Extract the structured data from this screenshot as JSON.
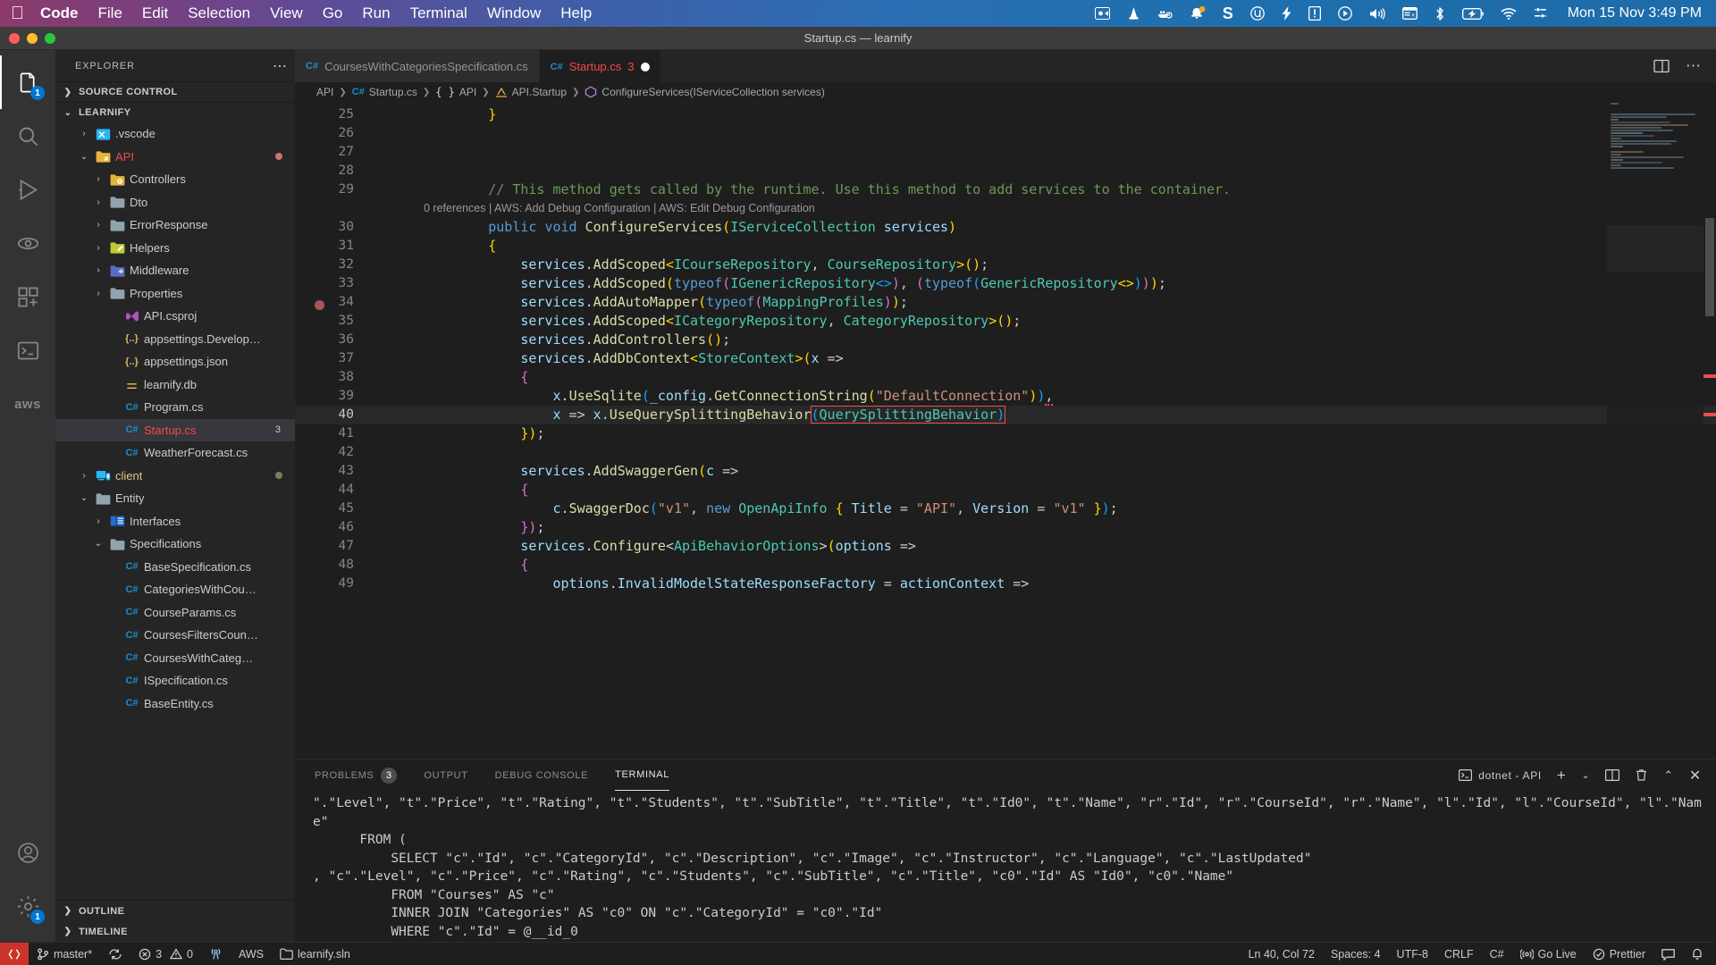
{
  "menubar": {
    "apple": "apple-logo",
    "items": [
      {
        "label": "Code",
        "bold": true
      },
      {
        "label": "File",
        "bold": false
      },
      {
        "label": "Edit",
        "bold": false
      },
      {
        "label": "Selection",
        "bold": false
      },
      {
        "label": "View",
        "bold": false
      },
      {
        "label": "Go",
        "bold": false
      },
      {
        "label": "Run",
        "bold": false
      },
      {
        "label": "Terminal",
        "bold": false
      },
      {
        "label": "Window",
        "bold": false
      },
      {
        "label": "Help",
        "bold": false
      }
    ],
    "tray_icons": [
      "screen-record-icon",
      "vlc-cone-icon",
      "docker-whale-icon",
      "notification-bell-icon",
      "sublime-s-icon",
      "utorrent-icon",
      "lightning-icon",
      "alert-exclamation-icon",
      "play-circle-icon",
      "volume-icon",
      "window-list-icon",
      "bluetooth-icon",
      "battery-charging-icon",
      "wifi-icon",
      "control-center-icon"
    ],
    "clock": "Mon 15 Nov  3:49 PM"
  },
  "window": {
    "title": "Startup.cs — learnify",
    "traffic_lights": [
      "close-button",
      "minimize-button",
      "maximize-button"
    ]
  },
  "activitybar": {
    "items": [
      {
        "name": "explorer",
        "icon": "files-icon",
        "active": true,
        "badge": "1"
      },
      {
        "name": "search",
        "icon": "search-icon",
        "active": false,
        "badge": ""
      },
      {
        "name": "run-and-debug",
        "icon": "debug-icon",
        "active": false,
        "badge": ""
      },
      {
        "name": "remote-explorer",
        "icon": "remote-icon",
        "active": false,
        "badge": ""
      },
      {
        "name": "extensions",
        "icon": "extensions-icon",
        "active": false,
        "badge": ""
      },
      {
        "name": "terminal-sidebar",
        "icon": "terminal-icon",
        "active": false,
        "badge": ""
      },
      {
        "name": "aws-toolkit",
        "icon": "aws-icon",
        "active": false,
        "badge": ""
      }
    ],
    "bottom": [
      {
        "name": "accounts",
        "icon": "account-icon",
        "badge": ""
      },
      {
        "name": "manage-settings",
        "icon": "gear-icon",
        "badge": "1"
      }
    ]
  },
  "sidebar": {
    "title": "EXPLORER",
    "actions_icon": "ellipsis-icon",
    "sections": [
      {
        "label": "SOURCE CONTROL",
        "expanded": false
      },
      {
        "label": "LEARNIFY",
        "expanded": true
      }
    ],
    "tree": [
      {
        "label": ".vscode",
        "indent": 1,
        "twisty": "›",
        "icon": "vscode-folder-icon",
        "iconColor": "#29b6f6",
        "kind": "folder",
        "color": "#cccccc"
      },
      {
        "label": "API",
        "indent": 1,
        "twisty": "⌄",
        "icon": "csharp-folder-icon",
        "iconColor": "#e8b339",
        "kind": "folder",
        "color": "#f14c4c",
        "dot": "#c4786b"
      },
      {
        "label": "Controllers",
        "indent": 2,
        "twisty": "›",
        "icon": "controllers-folder-icon",
        "iconColor": "#e8b339",
        "kind": "folder",
        "color": "#cccccc"
      },
      {
        "label": "Dto",
        "indent": 2,
        "twisty": "›",
        "icon": "folder-icon",
        "iconColor": "#90a4ae",
        "kind": "folder",
        "color": "#cccccc"
      },
      {
        "label": "ErrorResponse",
        "indent": 2,
        "twisty": "›",
        "icon": "folder-icon",
        "iconColor": "#90a4ae",
        "kind": "folder",
        "color": "#cccccc"
      },
      {
        "label": "Helpers",
        "indent": 2,
        "twisty": "›",
        "icon": "helpers-folder-icon",
        "iconColor": "#c0ca33",
        "kind": "folder",
        "color": "#cccccc"
      },
      {
        "label": "Middleware",
        "indent": 2,
        "twisty": "›",
        "icon": "middleware-folder-icon",
        "iconColor": "#5c6bc0",
        "kind": "folder",
        "color": "#cccccc"
      },
      {
        "label": "Properties",
        "indent": 2,
        "twisty": "›",
        "icon": "folder-icon",
        "iconColor": "#90a4ae",
        "kind": "folder",
        "color": "#cccccc"
      },
      {
        "label": "API.csproj",
        "indent": 3,
        "twisty": "",
        "icon": "visualstudio-icon",
        "iconColor": "#b052c0",
        "kind": "file",
        "color": "#cccccc"
      },
      {
        "label": "appsettings.Develop…",
        "indent": 3,
        "twisty": "",
        "icon": "json-icon",
        "iconColor": "#d7ba5d",
        "kind": "file",
        "color": "#cccccc"
      },
      {
        "label": "appsettings.json",
        "indent": 3,
        "twisty": "",
        "icon": "json-icon",
        "iconColor": "#d7ba5d",
        "kind": "file",
        "color": "#cccccc"
      },
      {
        "label": "learnify.db",
        "indent": 3,
        "twisty": "",
        "icon": "database-icon",
        "iconColor": "#e8c44a",
        "kind": "file",
        "color": "#cccccc"
      },
      {
        "label": "Program.cs",
        "indent": 3,
        "twisty": "",
        "icon": "csharp-icon",
        "iconColor": "#1f8ad2",
        "kind": "file",
        "color": "#cccccc"
      },
      {
        "label": "Startup.cs",
        "indent": 3,
        "twisty": "",
        "icon": "csharp-icon",
        "iconColor": "#1f8ad2",
        "kind": "file",
        "color": "#f14c4c",
        "selected": true,
        "count": "3"
      },
      {
        "label": "WeatherForecast.cs",
        "indent": 3,
        "twisty": "",
        "icon": "csharp-icon",
        "iconColor": "#1f8ad2",
        "kind": "file",
        "color": "#cccccc"
      },
      {
        "label": "client",
        "indent": 1,
        "twisty": "›",
        "icon": "client-folder-icon",
        "iconColor": "#29b6f6",
        "kind": "folder",
        "color": "#e2c08d",
        "dot": "#7d7d5f"
      },
      {
        "label": "Entity",
        "indent": 1,
        "twisty": "⌄",
        "icon": "folder-icon",
        "iconColor": "#90a4ae",
        "kind": "folder",
        "color": "#cccccc"
      },
      {
        "label": "Interfaces",
        "indent": 2,
        "twisty": "›",
        "icon": "interfaces-folder-icon",
        "iconColor": "#1f6fd0",
        "kind": "folder",
        "color": "#cccccc"
      },
      {
        "label": "Specifications",
        "indent": 2,
        "twisty": "⌄",
        "icon": "folder-icon",
        "iconColor": "#90a4ae",
        "kind": "folder",
        "color": "#cccccc"
      },
      {
        "label": "BaseSpecification.cs",
        "indent": 3,
        "twisty": "",
        "icon": "csharp-icon",
        "iconColor": "#1f8ad2",
        "kind": "file",
        "color": "#cccccc"
      },
      {
        "label": "CategoriesWithCou…",
        "indent": 3,
        "twisty": "",
        "icon": "csharp-icon",
        "iconColor": "#1f8ad2",
        "kind": "file",
        "color": "#cccccc"
      },
      {
        "label": "CourseParams.cs",
        "indent": 3,
        "twisty": "",
        "icon": "csharp-icon",
        "iconColor": "#1f8ad2",
        "kind": "file",
        "color": "#cccccc"
      },
      {
        "label": "CoursesFiltersCoun…",
        "indent": 3,
        "twisty": "",
        "icon": "csharp-icon",
        "iconColor": "#1f8ad2",
        "kind": "file",
        "color": "#cccccc"
      },
      {
        "label": "CoursesWithCateg…",
        "indent": 3,
        "twisty": "",
        "icon": "csharp-icon",
        "iconColor": "#1f8ad2",
        "kind": "file",
        "color": "#cccccc"
      },
      {
        "label": "ISpecification.cs",
        "indent": 3,
        "twisty": "",
        "icon": "csharp-icon",
        "iconColor": "#1f8ad2",
        "kind": "file",
        "color": "#cccccc"
      },
      {
        "label": "BaseEntity.cs",
        "indent": 3,
        "twisty": "",
        "icon": "csharp-icon",
        "iconColor": "#1f8ad2",
        "kind": "file",
        "color": "#cccccc"
      }
    ],
    "bottom_sections": [
      {
        "label": "OUTLINE",
        "expanded": false
      },
      {
        "label": "TIMELINE",
        "expanded": false
      }
    ]
  },
  "editor": {
    "tabs": [
      {
        "label": "CoursesWithCategoriesSpecification.cs",
        "icon": "csharp-icon",
        "active": false,
        "errors": "",
        "dirty": false
      },
      {
        "label": "Startup.cs",
        "icon": "csharp-icon",
        "active": true,
        "errors": "3",
        "dirty": true
      }
    ],
    "tab_actions": [
      "split-editor-icon",
      "more-actions-icon"
    ],
    "breadcrumbs": [
      {
        "label": "API",
        "icon": ""
      },
      {
        "label": "Startup.cs",
        "icon": "csharp-icon"
      },
      {
        "label": "API",
        "icon": "namespace-icon"
      },
      {
        "label": "API.Startup",
        "icon": "class-icon"
      },
      {
        "label": "ConfigureServices(IServiceCollection services)",
        "icon": "method-icon"
      }
    ],
    "first_line_number": 25,
    "codelens": "0 references | AWS: Add Debug Configuration | AWS: Edit Debug Configuration",
    "lines": [
      {
        "n": 25,
        "html": "        <span class='b1'>}</span>"
      },
      {
        "n": 26,
        "html": ""
      },
      {
        "n": 27,
        "html": ""
      },
      {
        "n": 28,
        "html": ""
      },
      {
        "n": 29,
        "html": "        <span class='c'>// This method gets called by the runtime. Use this method to add services to the container.</span>"
      },
      {
        "n": 30,
        "html": "        <span class='k'>public</span> <span class='k'>void</span> <span class='m'>ConfigureServices</span><span class='b1'>(</span><span class='t'>IServiceCollection</span> <span class='i'>services</span><span class='b1'>)</span>",
        "cursorline": false
      },
      {
        "n": 31,
        "html": "        <span class='b1'>{</span>"
      },
      {
        "n": 32,
        "html": "            <span class='i'>services</span>.<span class='m'>AddScoped</span><span class='b1'>&lt;</span><span class='t'>ICourseRepository</span>, <span class='t'>CourseRepository</span><span class='b1'>&gt;()</span>;"
      },
      {
        "n": 33,
        "html": "            <span class='i'>services</span>.<span class='m'>AddScoped</span><span class='b1'>(</span><span class='k'>typeof</span><span class='b2'>(</span><span class='t'>IGenericRepository</span><span class='b3'>&lt;&gt;</span><span class='b2'>)</span>, <span class='b2'>(</span><span class='k'>typeof</span><span class='b3'>(</span><span class='t'>GenericRepository</span><span class='b1'>&lt;&gt;</span><span class='b3'>)</span><span class='b2'>)</span><span class='b1'>)</span>;"
      },
      {
        "n": 34,
        "html": "            <span class='i'>services</span>.<span class='m'>AddAutoMapper</span><span class='b1'>(</span><span class='k'>typeof</span><span class='b2'>(</span><span class='t'>MappingProfiles</span><span class='b2'>)</span><span class='b1'>)</span>;"
      },
      {
        "n": 35,
        "html": "            <span class='i'>services</span>.<span class='m'>AddScoped</span><span class='b1'>&lt;</span><span class='t'>ICategoryRepository</span>, <span class='t'>CategoryRepository</span><span class='b1'>&gt;()</span>;"
      },
      {
        "n": 36,
        "html": "            <span class='i'>services</span>.<span class='m'>AddControllers</span><span class='b1'>()</span>;"
      },
      {
        "n": 37,
        "html": "            <span class='i'>services</span>.<span class='m'>AddDbContext</span><span class='b1'>&lt;</span><span class='t'>StoreContext</span><span class='b1'>&gt;(</span><span class='i'>x</span> =&gt;"
      },
      {
        "n": 38,
        "html": "            <span class='b2'>{</span>"
      },
      {
        "n": 39,
        "html": "                <span class='i'>x</span>.<span class='m'>UseSqlite</span><span class='b3'>(</span><span class='i'>_config</span>.<span class='m'>GetConnectionString</span><span class='b1'>(</span><span class='s'>\"DefaultConnection\"</span><span class='b1'>)</span><span class='b3'>)</span><span class='squig-red'>,</span>"
      },
      {
        "n": 40,
        "html": "                <span class='i'>x</span> =&gt; <span class='i'>x</span>.<span class='m'>UseQuerySplittingBehavior</span><span class='cursorbox'><span class='b3'>(</span><span class='t'>QuerySplittingBehavior</span><span class='b3'>)</span></span>",
        "cursorline": true
      },
      {
        "n": 41,
        "html": "            <span class='b1'>})</span>;"
      },
      {
        "n": 42,
        "html": ""
      },
      {
        "n": 43,
        "html": "            <span class='i'>services</span>.<span class='m'>AddSwaggerGen</span><span class='b1'>(</span><span class='i'>c</span> =&gt;"
      },
      {
        "n": 44,
        "html": "            <span class='b2'>{</span>"
      },
      {
        "n": 45,
        "html": "                <span class='i'>c</span>.<span class='m'>SwaggerDoc</span><span class='b3'>(</span><span class='s'>\"v1\"</span>, <span class='k'>new</span> <span class='t'>OpenApiInfo</span> <span class='b1'>{</span> <span class='i'>Title</span> = <span class='s'>\"API\"</span>, <span class='i'>Version</span> = <span class='s'>\"v1\"</span> <span class='b1'>}</span><span class='b3'>)</span>;"
      },
      {
        "n": 46,
        "html": "            <span class='b2'>})</span>;"
      },
      {
        "n": 47,
        "html": "            <span class='i'>services</span>.<span class='m'>Configure</span><span class='p'>&lt;</span><span class='t'>ApiBehaviorOptions</span><span class='p'>&gt;</span><span class='b1'>(</span><span class='i'>options</span> =&gt;"
      },
      {
        "n": 48,
        "html": "            <span class='b2'>{</span>"
      },
      {
        "n": 49,
        "html": "                <span class='i'>options</span>.<span class='i'>InvalidModelStateResponseFactory</span> = <span class='i'>actionContext</span> =&gt;"
      }
    ]
  },
  "panel": {
    "tabs": [
      {
        "label": "PROBLEMS",
        "badge": "3",
        "active": false
      },
      {
        "label": "OUTPUT",
        "badge": "",
        "active": false
      },
      {
        "label": "DEBUG CONSOLE",
        "badge": "",
        "active": false
      },
      {
        "label": "TERMINAL",
        "badge": "",
        "active": true
      }
    ],
    "terminal_selector": "dotnet - API",
    "terminal_selector_icon": "terminal-icon",
    "actions": [
      "new-terminal-icon",
      "chevron-down-icon",
      "split-terminal-icon",
      "kill-terminal-icon",
      "maximize-panel-icon",
      "close-panel-icon"
    ],
    "terminal_output": "\".\"Level\", \"t\".\"Price\", \"t\".\"Rating\", \"t\".\"Students\", \"t\".\"SubTitle\", \"t\".\"Title\", \"t\".\"Id0\", \"t\".\"Name\", \"r\".\"Id\", \"r\".\"CourseId\", \"r\".\"Name\", \"l\".\"Id\", \"l\".\"CourseId\", \"l\".\"Name\"\n      FROM (\n          SELECT \"c\".\"Id\", \"c\".\"CategoryId\", \"c\".\"Description\", \"c\".\"Image\", \"c\".\"Instructor\", \"c\".\"Language\", \"c\".\"LastUpdated\"\n, \"c\".\"Level\", \"c\".\"Price\", \"c\".\"Rating\", \"c\".\"Students\", \"c\".\"SubTitle\", \"c\".\"Title\", \"c0\".\"Id\" AS \"Id0\", \"c0\".\"Name\"\n          FROM \"Courses\" AS \"c\"\n          INNER JOIN \"Categories\" AS \"c0\" ON \"c\".\"CategoryId\" = \"c0\".\"Id\"\n          WHERE \"c\".\"Id\" = @__id_0"
  },
  "statusbar": {
    "remote_icon": "remote-indicator-icon",
    "left": [
      {
        "label": "master*",
        "icon": "source-control-icon"
      },
      {
        "label": "",
        "icon": "sync-icon"
      },
      {
        "label": "3",
        "icon": "error-icon",
        "label2": "0",
        "icon2": "warning-icon"
      },
      {
        "label": "",
        "icon": "radio-tower-icon"
      },
      {
        "label": "AWS",
        "icon": ""
      },
      {
        "label": "learnify.sln",
        "icon": "solution-icon"
      }
    ],
    "right": [
      {
        "label": "Ln 40, Col 72",
        "icon": ""
      },
      {
        "label": "Spaces: 4",
        "icon": ""
      },
      {
        "label": "UTF-8",
        "icon": ""
      },
      {
        "label": "CRLF",
        "icon": ""
      },
      {
        "label": "C#",
        "icon": ""
      },
      {
        "label": "Go Live",
        "icon": "broadcast-icon"
      },
      {
        "label": "Prettier",
        "icon": "check-circle-icon"
      },
      {
        "label": "",
        "icon": "feedback-icon"
      },
      {
        "label": "",
        "icon": "bell-icon"
      }
    ]
  }
}
